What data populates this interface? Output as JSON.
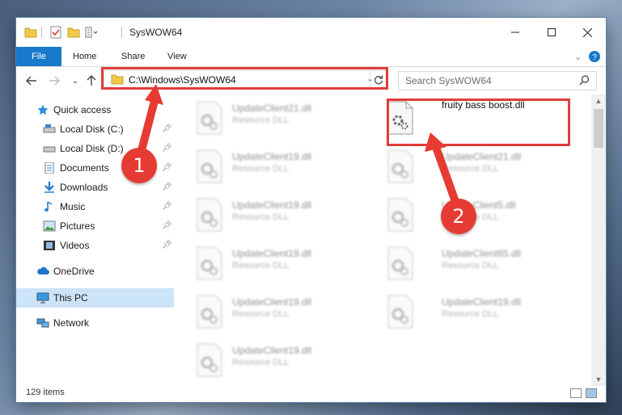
{
  "window": {
    "title": "SysWOW64"
  },
  "ribbon": {
    "tabs": [
      "File",
      "Home",
      "Share",
      "View"
    ]
  },
  "address": {
    "path": "C:\\Windows\\SysWOW64"
  },
  "search": {
    "placeholder": "Search SysWOW64"
  },
  "sidebar": {
    "quick_access": "Quick access",
    "items": [
      {
        "label": "Local Disk (C:)",
        "icon": "drive-icon"
      },
      {
        "label": "Local Disk (D:)",
        "icon": "drive-icon"
      },
      {
        "label": "Documents",
        "icon": "documents-icon"
      },
      {
        "label": "Downloads",
        "icon": "download-icon"
      },
      {
        "label": "Music",
        "icon": "music-icon"
      },
      {
        "label": "Pictures",
        "icon": "pictures-icon"
      },
      {
        "label": "Videos",
        "icon": "videos-icon"
      }
    ],
    "onedrive": "OneDrive",
    "this_pc": "This PC",
    "network": "Network"
  },
  "files": {
    "target": {
      "name": "fruity bass boost.dll"
    },
    "left": [
      {
        "name": "UpdateClient21.dll",
        "type": "Resource DLL"
      },
      {
        "name": "UpdateClient19.dll",
        "type": "Resource DLL"
      },
      {
        "name": "UpdateClient19.dll",
        "type": "Resource DLL"
      },
      {
        "name": "UpdateClient19.dll",
        "type": "Resource DLL"
      },
      {
        "name": "UpdateClient19.dll",
        "type": "Resource DLL"
      },
      {
        "name": "UpdateClient19.dll",
        "type": "Resource DLL"
      }
    ],
    "right": [
      {
        "name": "UpdateClient21.dll",
        "type": "Resource DLL"
      },
      {
        "name": "UpdateClient5.dll",
        "type": "Resource DLL"
      },
      {
        "name": "UpdateClient65.dll",
        "type": "Resource DLL"
      },
      {
        "name": "UpdateClient19.dll",
        "type": "Resource DLL"
      }
    ]
  },
  "status": {
    "items": "129 items"
  },
  "callouts": {
    "one": "1",
    "two": "2"
  },
  "colors": {
    "accent": "#1979ca",
    "highlight": "#e23b3b",
    "selected": "#cce4f7"
  }
}
